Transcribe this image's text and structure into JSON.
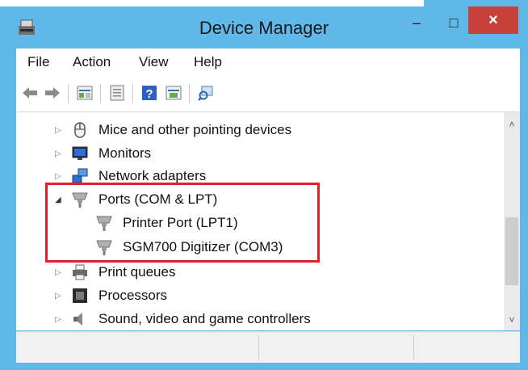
{
  "window": {
    "title": "Device Manager"
  },
  "window_controls": {
    "minimize": "–",
    "maximize": "□",
    "close": "×"
  },
  "menu": {
    "items": [
      "File",
      "Action",
      "View",
      "Help"
    ]
  },
  "toolbar": {
    "icons": [
      "back-icon",
      "forward-icon",
      "properties-icon",
      "update-icon",
      "help-icon",
      "view-icon",
      "scan-icon"
    ]
  },
  "tree": {
    "items": [
      {
        "label": "Mice and other pointing devices",
        "icon": "mouse-icon",
        "expander": "▷"
      },
      {
        "label": "Monitors",
        "icon": "monitor-icon",
        "expander": "▷"
      },
      {
        "label": "Network adapters",
        "icon": "network-icon",
        "expander": "▷"
      },
      {
        "label": "Ports (COM & LPT)",
        "icon": "port-icon",
        "expander": "◢"
      },
      {
        "label": "Printer Port (LPT1)",
        "icon": "port-icon"
      },
      {
        "label": "SGM700 Digitizer (COM3)",
        "icon": "port-icon"
      },
      {
        "label": "Print queues",
        "icon": "printer-icon",
        "expander": "▷"
      },
      {
        "label": "Processors",
        "icon": "processor-icon",
        "expander": "▷"
      },
      {
        "label": "Sound, video and game controllers",
        "icon": "speaker-icon",
        "expander": "▷"
      }
    ]
  },
  "scrollbar": {
    "up": "˄",
    "down": "˅"
  },
  "colors": {
    "frame": "#5fb8e8",
    "close": "#c7403a",
    "highlight": "#e0202a"
  }
}
